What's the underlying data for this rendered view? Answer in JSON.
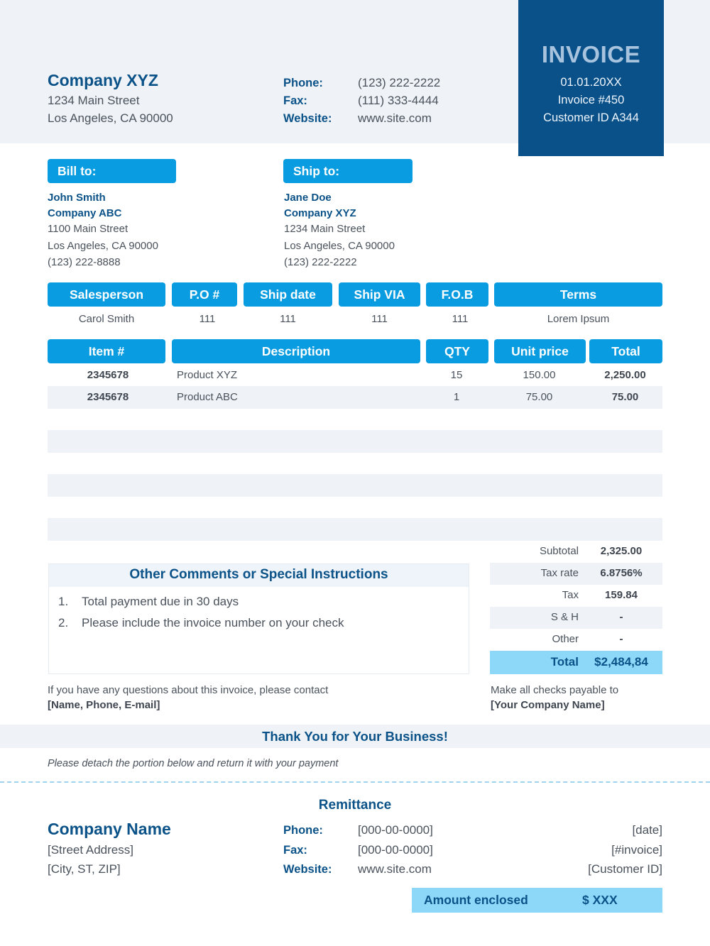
{
  "colors": {
    "brand_dark": "#0a5189",
    "brand_accent": "#0a9ce0",
    "highlight": "#8dd7f8",
    "band_bg": "#eff3f7",
    "text": "#4a525c"
  },
  "header": {
    "company_name": "Company XYZ",
    "address_line1": "1234 Main Street",
    "address_line2": "Los Angeles, CA 90000",
    "contacts": [
      {
        "label": "Phone:",
        "value": "(123) 222-2222"
      },
      {
        "label": "Fax:",
        "value": "(111) 333-4444"
      },
      {
        "label": "Website:",
        "value": "www.site.com"
      }
    ]
  },
  "invoice_box": {
    "title": "INVOICE",
    "date": "01.01.20XX",
    "invoice_number": "Invoice #450",
    "customer_id": "Customer ID A344"
  },
  "bill_to": {
    "heading": "Bill to:",
    "name": "John Smith",
    "company": "Company ABC",
    "street": "1100 Main Street",
    "city": "Los Angeles, CA 90000",
    "phone": "(123) 222-8888"
  },
  "ship_to": {
    "heading": "Ship to:",
    "name": "Jane Doe",
    "company": "Company XYZ",
    "street": "1234 Main Street",
    "city": "Los Angeles, CA 90000",
    "phone": "(123) 222-2222"
  },
  "order_info": {
    "headers": [
      "Salesperson",
      "P.O #",
      "Ship date",
      "Ship VIA",
      "F.O.B",
      "Terms"
    ],
    "values": [
      "Carol Smith",
      "111",
      "111",
      "111",
      "111",
      "Lorem Ipsum"
    ]
  },
  "items": {
    "headers": [
      "Item #",
      "Description",
      "QTY",
      "Unit price",
      "Total"
    ],
    "rows": [
      {
        "item": "2345678",
        "description": "Product XYZ",
        "qty": "15",
        "unit_price": "150.00",
        "total": "2,250.00"
      },
      {
        "item": "2345678",
        "description": "Product ABC",
        "qty": "1",
        "unit_price": "75.00",
        "total": "75.00"
      }
    ]
  },
  "comments": {
    "heading": "Other Comments or Special Instructions",
    "items": [
      {
        "num": "1.",
        "text": "Total payment due in 30 days"
      },
      {
        "num": "2.",
        "text": "Please include the invoice number on your check"
      }
    ],
    "contact_note": "If you have any questions about this invoice, please contact",
    "contact_placeholder": "[Name, Phone, E-mail]"
  },
  "totals": {
    "rows": [
      {
        "label": "Subtotal",
        "value": "2,325.00"
      },
      {
        "label": "Tax rate",
        "value": "6.8756%"
      },
      {
        "label": "Tax",
        "value": "159.84"
      },
      {
        "label": "S & H",
        "value": "-"
      },
      {
        "label": "Other",
        "value": "-"
      }
    ],
    "grand_label": "Total",
    "grand_value": "$2,484,84",
    "payable_note": "Make all checks payable to",
    "payable_name": "[Your Company Name]"
  },
  "footer": {
    "thanks": "Thank You for Your Business!",
    "detach_note": "Please detach the portion below and return it with your payment"
  },
  "remittance": {
    "title": "Remittance",
    "company_name": "Company Name",
    "street": "[Street Address]",
    "city": "[City, ST, ZIP]",
    "contacts": [
      {
        "label": "Phone:",
        "value": "[000-00-0000]"
      },
      {
        "label": "Fax:",
        "value": "[000-00-0000]"
      },
      {
        "label": "Website:",
        "value": "www.site.com"
      }
    ],
    "date": "[date]",
    "invoice": "[#invoice]",
    "customer_id": "[Customer ID]",
    "amount_label": "Amount enclosed",
    "amount_value": "$ XXX"
  }
}
